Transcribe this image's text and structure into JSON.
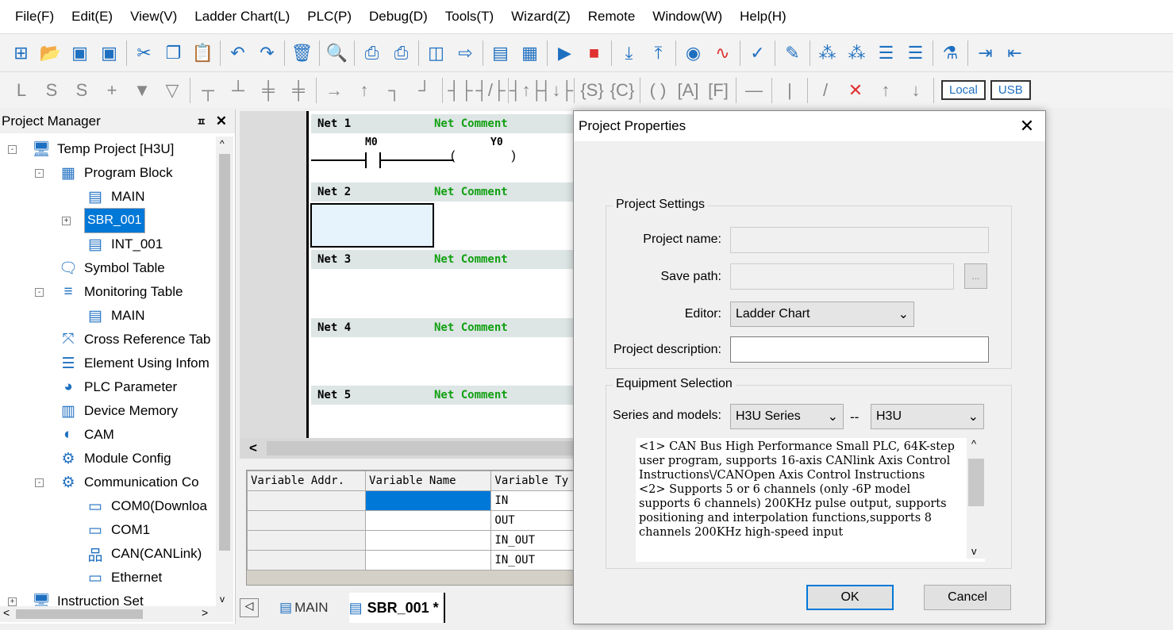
{
  "menu": [
    "File(F)",
    "Edit(E)",
    "View(V)",
    "Ladder Chart(L)",
    "PLC(P)",
    "Debug(D)",
    "Tools(T)",
    "Wizard(Z)",
    "Remote",
    "Window(W)",
    "Help(H)"
  ],
  "toolbar1": [
    "new-icon",
    "open-icon",
    "save-icon",
    "save-all-icon",
    "|",
    "cut-icon",
    "copy-icon",
    "paste-icon",
    "|",
    "undo-icon",
    "redo-icon",
    "|",
    "delete-icon",
    "|",
    "search-icon",
    "|",
    "print-preview-icon",
    "print-icon",
    "|",
    "window-icon",
    "window-export-icon",
    "|",
    "compile-icon",
    "compile-all-icon",
    "|",
    "run-icon",
    "stop-icon",
    "|",
    "download-icon",
    "upload-icon",
    "|",
    "monitor-icon",
    "trace-icon",
    "|",
    "debug-icon",
    "|",
    "edit-icon",
    "|",
    "grid-icon",
    "grid-off-icon",
    "insert-row-icon",
    "delete-row-icon",
    "|",
    "test-icon",
    "|",
    "login-icon",
    "logout-icon"
  ],
  "toolbar2": [
    "lad-icon",
    "stl-icon",
    "sfc-icon",
    "cross-icon",
    "down-arrow-icon",
    "down-hollow-icon",
    "|",
    "branch-icon",
    "branch2-icon",
    "branch3-icon",
    "branch4-icon",
    "|",
    "hline-icon",
    "vline-icon",
    "corner-icon",
    "corner2-icon",
    "|",
    "contact-no-icon",
    "contact-nc-icon",
    "|",
    "rising-icon",
    "falling-icon",
    "|",
    "s-instr-icon",
    "c-instr-icon",
    "|",
    "coil-icon",
    "a-instr-icon",
    "f-instr-icon",
    "|",
    "h-line-icon",
    "|",
    "v-line-icon",
    "|",
    "slash-icon",
    "x-icon",
    "up-icon",
    "down-icon",
    "|"
  ],
  "toolbar2_buttons": {
    "local": "Local",
    "usb": "USB"
  },
  "project_manager": {
    "title": "Project Manager",
    "pin": "📌",
    "close": "✕",
    "tree": [
      {
        "label": "Temp Project [H3U]",
        "level": 0,
        "icon": "computer-icon",
        "exp": "-"
      },
      {
        "label": "Program Block",
        "level": 1,
        "icon": "blocks-icon",
        "exp": "-"
      },
      {
        "label": "MAIN",
        "level": 2,
        "icon": "main-program-icon"
      },
      {
        "label": "SBR_001",
        "level": 2,
        "icon": "subroutine-icon",
        "exp": "+",
        "selected": true
      },
      {
        "label": "INT_001",
        "level": 2,
        "icon": "interrupt-icon"
      },
      {
        "label": "Symbol Table",
        "level": 1,
        "icon": "symbol-table-icon"
      },
      {
        "label": "Monitoring Table",
        "level": 1,
        "icon": "monitoring-icon",
        "exp": "-"
      },
      {
        "label": "MAIN",
        "level": 2,
        "icon": "table-icon"
      },
      {
        "label": "Cross Reference Tab",
        "level": 1,
        "icon": "cross-ref-icon"
      },
      {
        "label": "Element Using Infom",
        "level": 1,
        "icon": "database-icon"
      },
      {
        "label": "PLC Parameter",
        "level": 1,
        "icon": "globe-icon"
      },
      {
        "label": "Device Memory",
        "level": 1,
        "icon": "memory-icon"
      },
      {
        "label": "CAM",
        "level": 1,
        "icon": "cam-icon"
      },
      {
        "label": "Module Config",
        "level": 1,
        "icon": "module-config-icon"
      },
      {
        "label": "Communication Co",
        "level": 1,
        "icon": "communication-icon",
        "exp": "-"
      },
      {
        "label": "COM0(Downloa",
        "level": 2,
        "icon": "serial-port-icon"
      },
      {
        "label": "COM1",
        "level": 2,
        "icon": "serial-port-icon"
      },
      {
        "label": "CAN(CANLink)",
        "level": 2,
        "icon": "network-icon"
      },
      {
        "label": "Ethernet",
        "level": 2,
        "icon": "ethernet-icon"
      },
      {
        "label": "Instruction Set",
        "level": 0,
        "icon": "instruction-icon",
        "exp": "+"
      }
    ]
  },
  "editor": {
    "nets": [
      {
        "label": "Net 1",
        "comment": "Net Comment"
      },
      {
        "label": "Net 2",
        "comment": "Net Comment"
      },
      {
        "label": "Net 3",
        "comment": "Net Comment"
      },
      {
        "label": "Net 4",
        "comment": "Net Comment"
      },
      {
        "label": "Net 5",
        "comment": "Net Comment"
      }
    ],
    "contact": "M0",
    "coil": "Y0"
  },
  "var_table": {
    "headers": [
      "Variable Addr.",
      "Variable Name",
      "Variable Ty"
    ],
    "rows": [
      [
        "",
        "",
        "IN"
      ],
      [
        "",
        "",
        "OUT"
      ],
      [
        "",
        "",
        "IN_OUT"
      ],
      [
        "",
        "",
        "IN_OUT"
      ]
    ]
  },
  "tabs": [
    {
      "label": "MAIN",
      "icon": "main-program-icon"
    },
    {
      "label": "SBR_001 *",
      "icon": "subroutine-icon",
      "active": true
    }
  ],
  "dialog": {
    "title": "Project Properties",
    "project_settings": {
      "title": "Project Settings",
      "name_label": "Project name:",
      "name": "",
      "path_label": "Save path:",
      "path": "",
      "browse": "...",
      "editor_label": "Editor:",
      "editor": "Ladder Chart",
      "desc_label": "Project description:",
      "desc": ""
    },
    "equipment": {
      "title": "Equipment Selection",
      "series_label": "Series and models:",
      "series": "H3U Series",
      "dash": "--",
      "model": "H3U",
      "description": "<1> CAN Bus High Performance Small PLC, 64K-step user program, supports 16-axis CANlink Axis Control Instructions\\/CANOpen Axis Control Instructions\n<2> Supports 5 or 6 channels (only -6P model supports 6 channels) 200KHz pulse output, supports positioning and interpolation functions,supports 8 channels 200KHz high-speed input"
    },
    "ok": "OK",
    "cancel": "Cancel"
  }
}
